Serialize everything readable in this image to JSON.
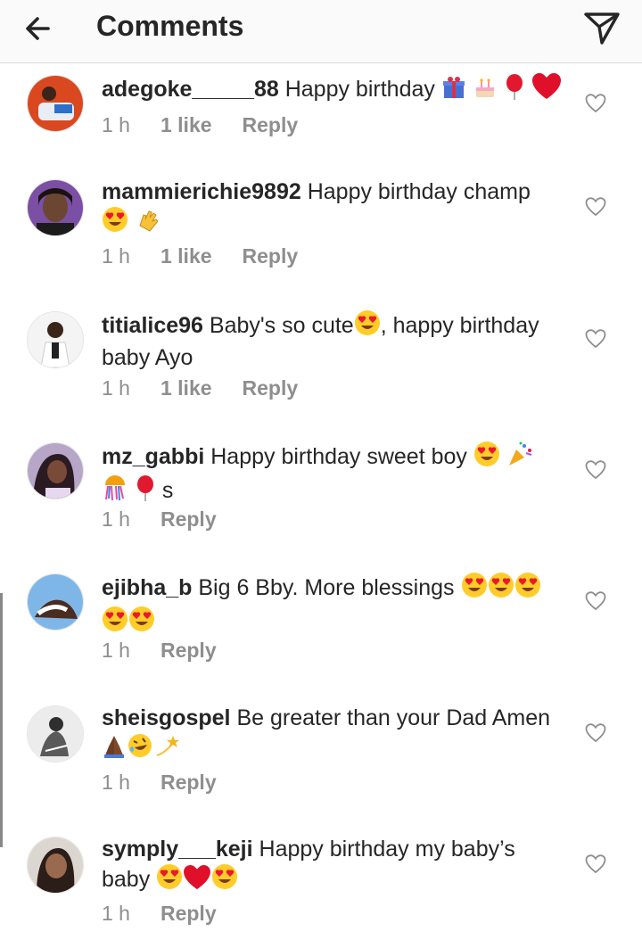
{
  "header": {
    "title": "Comments"
  },
  "comments": [
    {
      "username": "adegoke_____88",
      "text": "Happy birthday",
      "line2": "",
      "emojis": [
        "gift",
        "cake",
        "balloon",
        "heart"
      ],
      "emojis_line2": [],
      "time": "1 h",
      "likes": "1 like",
      "reply": "Reply"
    },
    {
      "username": "mammierichie9892",
      "text": "Happy birthday champ",
      "line2": "",
      "emojis": [],
      "emojis_line2": [
        "heart-eyes",
        "clap"
      ],
      "time": "1 h",
      "likes": "1 like",
      "reply": "Reply"
    },
    {
      "username": "titialice96",
      "text": "Baby's so cute",
      "text_after": ", happy birthday",
      "line2": "baby Ayo",
      "emojis": [
        "heart-eyes"
      ],
      "emojis_line2": [],
      "time": "1 h",
      "likes": "1 like",
      "reply": "Reply"
    },
    {
      "username": "mz_gabbi",
      "text": "Happy birthday sweet boy",
      "line2": "s",
      "emojis": [
        "heart-eyes",
        "party-popper"
      ],
      "emojis_line2": [
        "confetti",
        "balloon"
      ],
      "time": "1 h",
      "likes": "",
      "reply": "Reply"
    },
    {
      "username": "ejibha_b",
      "text": "Big 6 Bby. More blessings",
      "line2": "",
      "emojis": [
        "heart-eyes",
        "heart-eyes",
        "heart-eyes"
      ],
      "emojis_line2": [
        "heart-eyes",
        "heart-eyes"
      ],
      "time": "1 h",
      "likes": "",
      "reply": "Reply"
    },
    {
      "username": "sheisgospel",
      "text": "Be greater than your Dad Amen",
      "line2": "",
      "emojis": [],
      "emojis_line2": [
        "praying-hands",
        "rofl",
        "dizzy"
      ],
      "time": "1 h",
      "likes": "",
      "reply": "Reply"
    },
    {
      "username": "symply___keji",
      "text": "Happy birthday my baby’s",
      "line2": "baby",
      "emojis": [],
      "emojis_line2": [
        "heart-eyes",
        "heart",
        "heart-eyes"
      ],
      "time": "1 h",
      "likes": "",
      "reply": "Reply"
    }
  ],
  "icons": {
    "back": "arrow-left-icon",
    "send": "paper-plane-icon",
    "like": "heart-outline-icon"
  },
  "colors": {
    "text": "#262626",
    "meta": "#8e8e8e",
    "divider": "#dbdbdb"
  }
}
